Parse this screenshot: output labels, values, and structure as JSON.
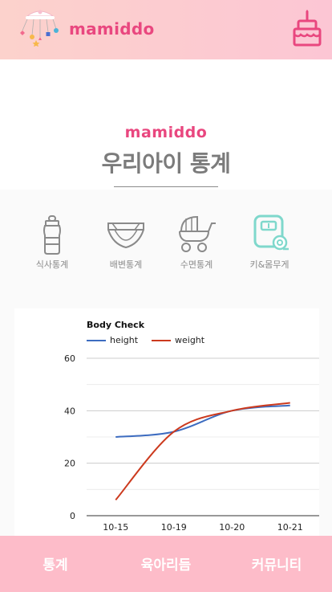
{
  "header": {
    "brand": "mamiddo",
    "logo_icon": "baby-mobile-icon",
    "cake_icon": "birthday-cake-icon"
  },
  "hero": {
    "subtitle": "mamiddo",
    "title": "우리아이 통계"
  },
  "stat_tabs": [
    {
      "label": "식사통계",
      "icon": "baby-bottle-icon"
    },
    {
      "label": "배변통계",
      "icon": "diaper-icon"
    },
    {
      "label": "수면통계",
      "icon": "stroller-icon"
    },
    {
      "label": "키&몸무게",
      "icon": "scale-icon",
      "active": true
    }
  ],
  "colors": {
    "brand": "#e9477f",
    "header_bg_start": "#fcd2cc",
    "header_bg_end": "#fcc6d4",
    "nav_bg": "#fdbcc9",
    "active_icon": "#7fd8cc",
    "icon_gray": "#8a8a8a",
    "height_line": "#3d6cc0",
    "weight_line": "#cc3a1e"
  },
  "chart_data": {
    "type": "line",
    "title": "Body Check",
    "categories": [
      "10-15",
      "10-19",
      "10-20",
      "10-21"
    ],
    "series": [
      {
        "name": "height",
        "values": [
          30,
          32,
          40,
          42
        ],
        "color": "#3d6cc0"
      },
      {
        "name": "weight",
        "values": [
          6,
          32,
          40,
          43
        ],
        "color": "#cc3a1e"
      }
    ],
    "ylim": [
      0,
      60
    ],
    "yticks": [
      0,
      20,
      40,
      60
    ],
    "grid": true,
    "legend": "top-left"
  },
  "bottom_nav": [
    {
      "label": "통계"
    },
    {
      "label": "육아리듬"
    },
    {
      "label": "커뮤니티"
    }
  ]
}
